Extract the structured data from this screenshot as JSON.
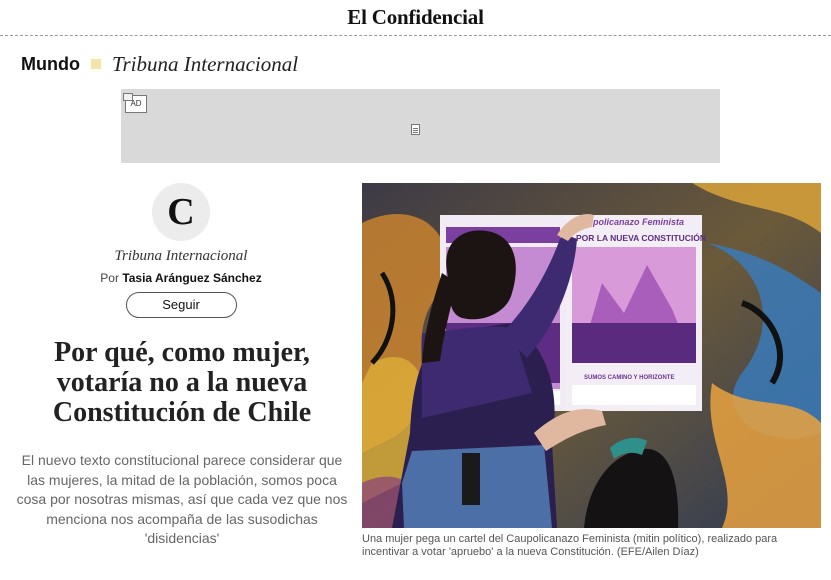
{
  "masthead": {
    "logo": "El Confidencial"
  },
  "section": {
    "name": "Mundo",
    "subsection": "Tribuna Internacional"
  },
  "ad": {
    "badge": "AD"
  },
  "author": {
    "avatar_letter": "C",
    "blog_name": "Tribuna Internacional",
    "by_prefix": "Por",
    "by_name": "Tasia Aránguez Sánchez",
    "follow_label": "Seguir"
  },
  "article": {
    "headline": "Por qué, como mujer, votaría no a la nueva Constitución de Chile",
    "dek": "El nuevo texto constitucional parece considerar que las mujeres, la mitad de la población, somos poca cosa por nosotras mismas, así que cada vez que nos menciona nos acompaña de las susodichas 'disidencias'"
  },
  "photo": {
    "poster_title_1": "Caupolicanazo Feminista",
    "poster_title_2": "POR LA NUEVA CONSTITUCIÓN",
    "poster_footer": "SUMOS CAMINO Y HORIZONTE",
    "caption": "Una mujer pega un cartel del Caupolicanazo Feminista (mitin político), realizado para incentivar a votar 'apruebo' a la nueva Constitución. (EFE/Ailen Díaz)"
  },
  "colors": {
    "section_dot": "#f6e3a6",
    "ad_background": "#d9d9d9",
    "poster_purple": "#7b3fa0",
    "jacket_purple": "#3e2a70"
  }
}
